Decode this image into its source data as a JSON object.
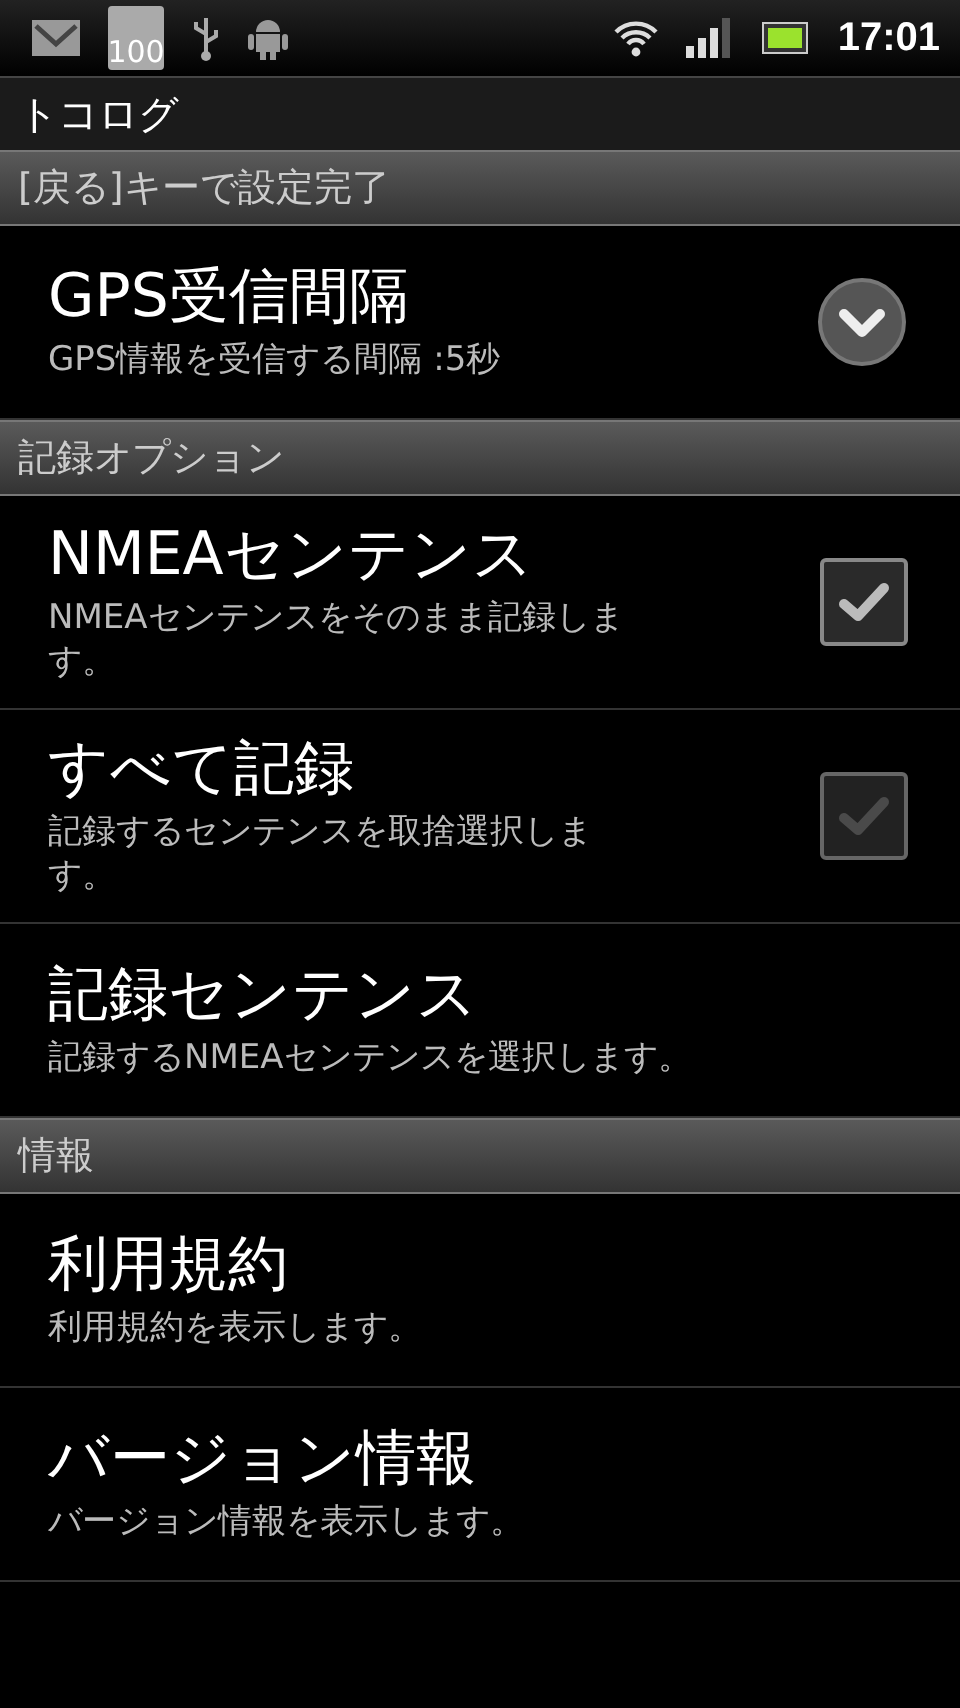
{
  "status_bar": {
    "notification_badge": "100",
    "time": "17:01"
  },
  "title_bar": {
    "title": "トコログ"
  },
  "sections": [
    {
      "header": "[戻る]キーで設定完了",
      "items": [
        {
          "kind": "dropdown",
          "title": "GPS受信間隔",
          "summary": "GPS情報を受信する間隔 :5秒"
        }
      ]
    },
    {
      "header": "記録オプション",
      "items": [
        {
          "kind": "checkbox",
          "title": "NMEAセンテンス",
          "summary": "NMEAセンテンスをそのまま記録します。",
          "checked": true,
          "disabled": false
        },
        {
          "kind": "checkbox",
          "title": "すべて記録",
          "summary": "記録するセンテンスを取捨選択します。",
          "checked": true,
          "disabled": true
        },
        {
          "kind": "plain",
          "title": "記録センテンス",
          "summary": "記録するNMEAセンテンスを選択します。"
        }
      ]
    },
    {
      "header": "情報",
      "items": [
        {
          "kind": "plain",
          "title": "利用規約",
          "summary": "利用規約を表示します。"
        },
        {
          "kind": "plain",
          "title": "バージョン情報",
          "summary": "バージョン情報を表示します。"
        }
      ]
    }
  ]
}
